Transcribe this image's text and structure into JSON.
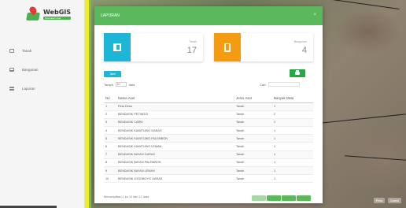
{
  "app": {
    "logo_title": "WebGIS",
    "logo_subtitle": "Pemetaan Aset"
  },
  "sidebar": {
    "items": [
      {
        "label": "Tanah",
        "icon": "map-icon"
      },
      {
        "label": "Bangunan",
        "icon": "building-icon"
      },
      {
        "label": "Laporan",
        "icon": "report-icon"
      }
    ]
  },
  "map": {
    "attribution": [
      "Peta",
      "Satelit"
    ]
  },
  "modal": {
    "title": "LAPORAN",
    "close": "×",
    "cards": {
      "tanah": {
        "label": "Tanah",
        "value": "17",
        "color": "#1fb5d6"
      },
      "bangunan": {
        "label": "Bangunan",
        "value": "4",
        "color": "#f39c12"
      }
    },
    "blue_button": "Tabel",
    "show_prefix": "Tampil",
    "show_value": "10",
    "show_suffix": "data",
    "search_label": "Cari:",
    "table": {
      "headers": [
        "No",
        "Nama Aset",
        "Jenis Aset",
        "Banyak Data"
      ],
      "rows": [
        [
          "1",
          "Peta Desa",
          "Tanah",
          "1"
        ],
        [
          "2",
          "BENDASIK PETINGGI",
          "Tanah",
          "2"
        ],
        [
          "3",
          "BENDASIK CARIK",
          "Tanah",
          "2"
        ],
        [
          "4",
          "BENDASIK KAMITUWO GARAS",
          "Tanah",
          "1"
        ],
        [
          "5",
          "BENDASIK KAMITUWO PALEMBON",
          "Tanah",
          "1"
        ],
        [
          "6",
          "BENDASIK KAMITUWO LEMAN",
          "Tanah",
          "1"
        ],
        [
          "7",
          "BENDASIK BAYAN GARAS",
          "Tanah",
          "1"
        ],
        [
          "8",
          "BENDASIK BAYAN PALEMBON",
          "Tanah",
          "1"
        ],
        [
          "9",
          "BENDASIK BAYAN LEMAN",
          "Tanah",
          "1"
        ],
        [
          "10",
          "BENDASIK JOGOBOYO GARAS",
          "Tanah",
          "1"
        ]
      ]
    },
    "info": "Menampilkan 1 ke 10 dari 17 data"
  },
  "colors": {
    "header_green": "#5cb85c",
    "accent_blue": "#1fb5d6",
    "accent_orange": "#f39c12",
    "print_green": "#28a745"
  }
}
